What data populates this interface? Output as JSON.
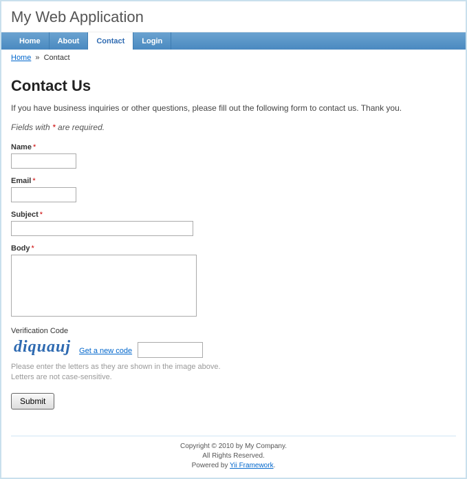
{
  "header": {
    "title": "My Web Application"
  },
  "menu": {
    "home": "Home",
    "about": "About",
    "contact": "Contact",
    "login": "Login"
  },
  "breadcrumbs": {
    "home": "Home",
    "sep": "»",
    "current": "Contact"
  },
  "page": {
    "heading": "Contact Us",
    "intro": "If you have business inquiries or other questions, please fill out the following form to contact us. Thank you.",
    "note_prefix": "Fields with ",
    "note_star": "*",
    "note_suffix": " are required."
  },
  "form": {
    "name_label": "Name",
    "email_label": "Email",
    "subject_label": "Subject",
    "body_label": "Body",
    "verify_label": "Verification Code",
    "captcha_text": "diquauj",
    "new_code": "Get a new code",
    "hint1": "Please enter the letters as they are shown in the image above.",
    "hint2": "Letters are not case-sensitive.",
    "submit": "Submit",
    "required": "*"
  },
  "footer": {
    "line1": "Copyright © 2010 by My Company.",
    "line2": "All Rights Reserved.",
    "line3_prefix": "Powered by ",
    "line3_link": "Yii Framework",
    "line3_suffix": "."
  }
}
